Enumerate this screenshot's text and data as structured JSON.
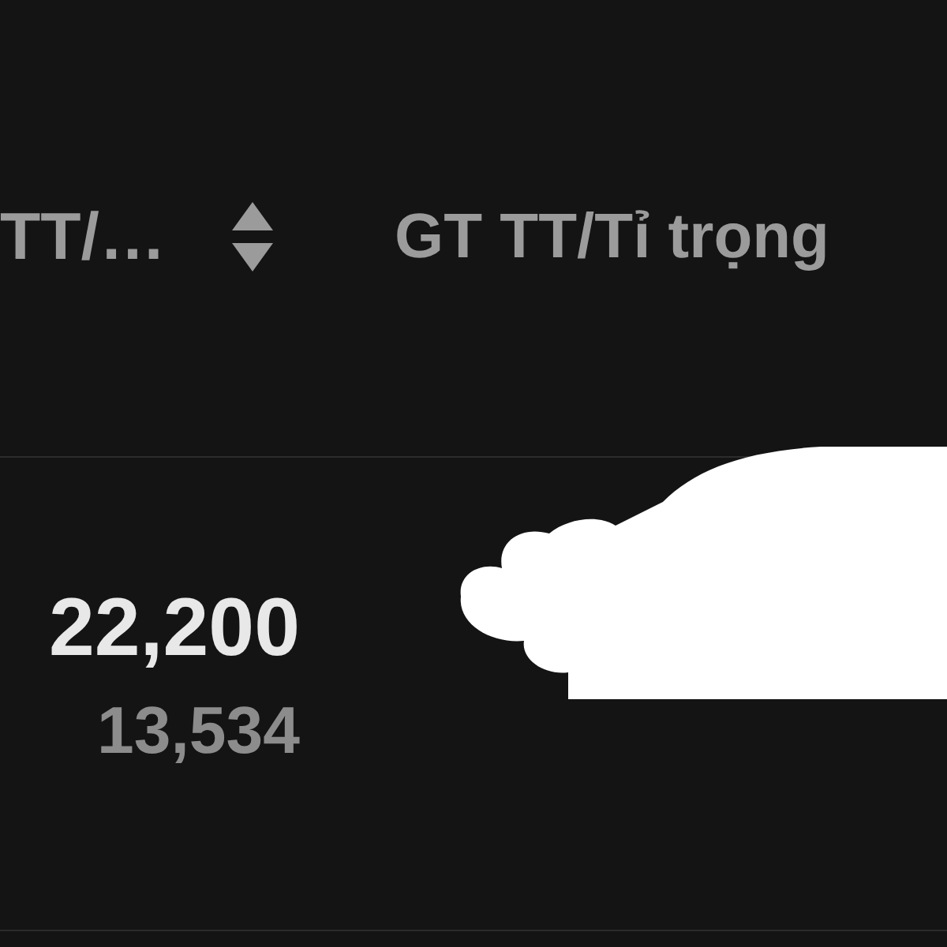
{
  "table": {
    "columns": [
      {
        "label": "TT/…",
        "sortable": true
      },
      {
        "label": "GT TT/Tỉ trọng"
      }
    ],
    "rows": [
      {
        "value": "22,200",
        "sub_value": "13,534"
      }
    ]
  }
}
